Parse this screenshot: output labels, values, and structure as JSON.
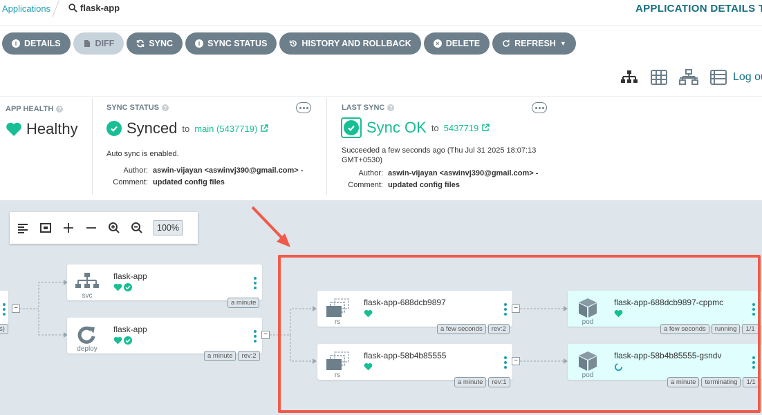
{
  "header": {
    "breadcrumb_root": "Applications",
    "app_name": "flask-app",
    "title": "APPLICATION DETAILS TRE"
  },
  "actions": {
    "details": "DETAILS",
    "diff": "DIFF",
    "sync": "SYNC",
    "sync_status": "SYNC STATUS",
    "history": "HISTORY AND ROLLBACK",
    "delete": "DELETE",
    "refresh": "REFRESH"
  },
  "views": {
    "logout": "Log ou"
  },
  "app_health": {
    "title": "APP HEALTH",
    "value": "Healthy"
  },
  "sync_status": {
    "title": "SYNC STATUS",
    "value": "Synced",
    "to": "to",
    "revision": "main (5437719)",
    "note": "Auto sync is enabled.",
    "author_label": "Author:",
    "author": "aswin-vijayan <aswinvj390@gmail.com> -",
    "comment_label": "Comment:",
    "comment": "updated config files"
  },
  "last_sync": {
    "title": "LAST SYNC",
    "value": "Sync OK",
    "to": "to",
    "revision": "5437719",
    "note_line1": "Succeeded a few seconds ago (Thu Jul 31 2025 18:07:13",
    "note_line2": "GMT+0530)",
    "author_label": "Author:",
    "author": "aswin-vijayan <aswinvj390@gmail.com> -",
    "comment_label": "Comment:",
    "comment": "updated config files"
  },
  "zoom": {
    "level": "100%"
  },
  "nodes": {
    "left_stub_badge": "s)",
    "svc": {
      "name": "flask-app",
      "kind": "svc",
      "badges": [
        "a minute"
      ]
    },
    "deploy": {
      "name": "flask-app",
      "kind": "deploy",
      "badges": [
        "a minute",
        "rev:2"
      ]
    },
    "rs1": {
      "name": "flask-app-688dcb9897",
      "kind": "rs",
      "badges": [
        "a few seconds",
        "rev:2"
      ]
    },
    "rs2": {
      "name": "flask-app-58b4b85555",
      "kind": "rs",
      "badges": [
        "a minute",
        "rev:1"
      ]
    },
    "pod1": {
      "name": "flask-app-688dcb9897-cppmc",
      "kind": "pod",
      "badges": [
        "a few seconds",
        "running",
        "1/1"
      ]
    },
    "pod2": {
      "name": "flask-app-58b4b85555-gsndv",
      "kind": "pod",
      "badges": [
        "a minute",
        "terminating",
        "1/1"
      ]
    }
  },
  "colors": {
    "accent": "#1f9fb0",
    "healthy": "#18be94",
    "highlight": "#ef5a4a",
    "button": "#6d7f8b"
  }
}
